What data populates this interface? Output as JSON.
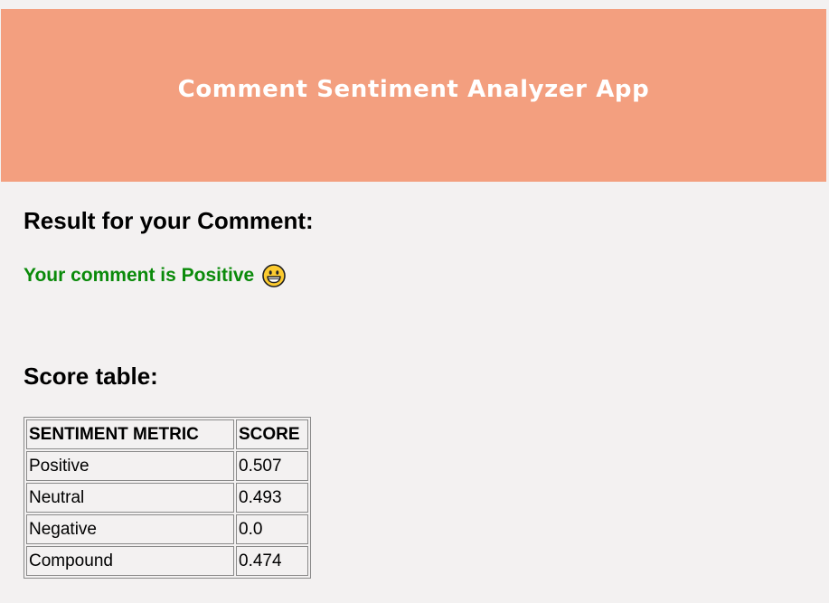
{
  "header": {
    "title": "Comment Sentiment Analyzer App",
    "background_color": "#f39f7f"
  },
  "result": {
    "heading": "Result for your Comment:",
    "message": "Your comment is Positive",
    "message_color": "#0a8a0a",
    "emoji_icon": "grinning-face-icon"
  },
  "score_table": {
    "heading": "Score table:",
    "columns": [
      "SENTIMENT METRIC",
      "SCORE"
    ],
    "rows": [
      {
        "metric": "Positive",
        "score": "0.507"
      },
      {
        "metric": "Neutral",
        "score": "0.493"
      },
      {
        "metric": "Negative",
        "score": "0.0"
      },
      {
        "metric": "Compound",
        "score": "0.474"
      }
    ]
  }
}
